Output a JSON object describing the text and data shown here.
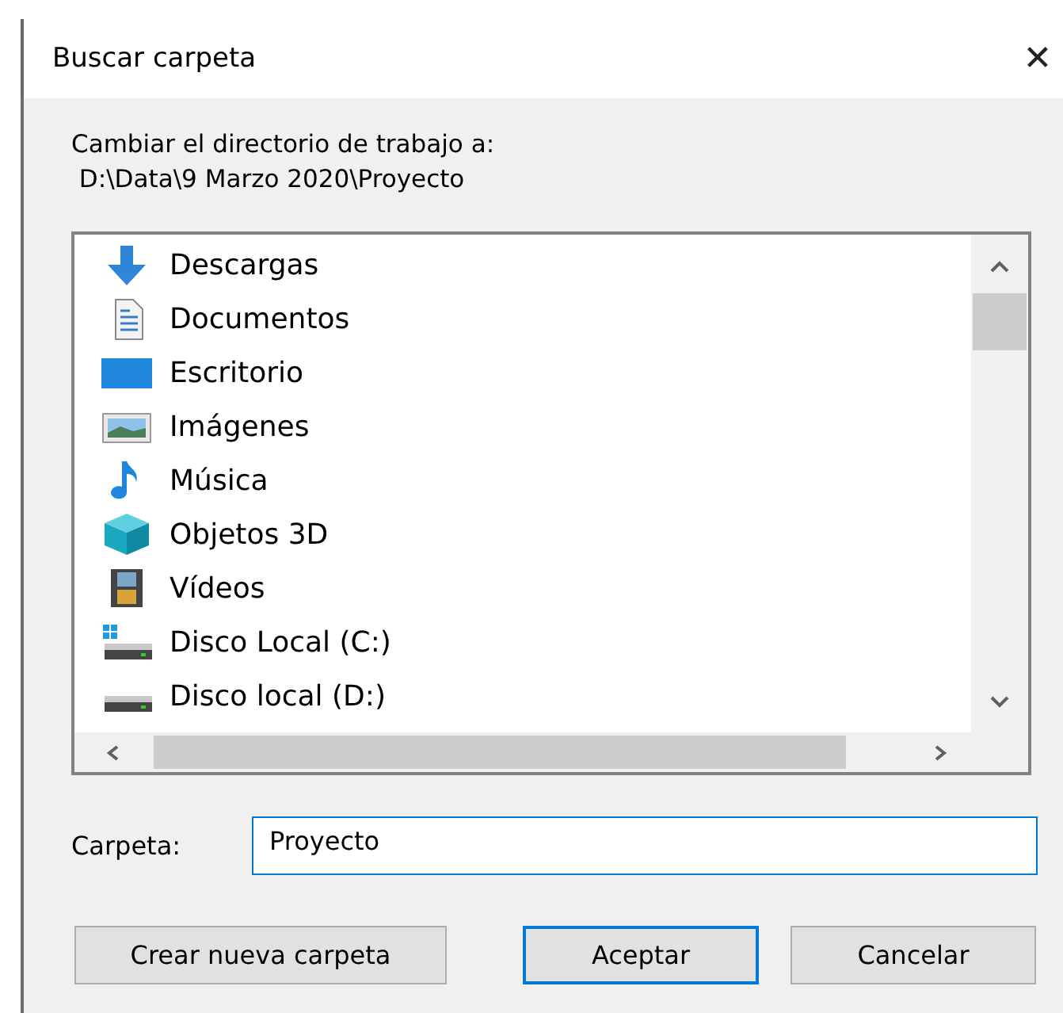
{
  "window": {
    "title": "Buscar carpeta",
    "close": "✕"
  },
  "description": {
    "line_1": "Cambiar el directorio de trabajo a:",
    "line_2": " D:\\Data\\9 Marzo 2020\\Proyecto"
  },
  "tree": {
    "items": [
      {
        "label": "Descargas",
        "kind": "downloads"
      },
      {
        "label": "Documentos",
        "kind": "documents"
      },
      {
        "label": "Escritorio",
        "kind": "desktop"
      },
      {
        "label": "Imágenes",
        "kind": "pictures"
      },
      {
        "label": "Música",
        "kind": "music"
      },
      {
        "label": "Objetos 3D",
        "kind": "objects3d"
      },
      {
        "label": "Vídeos",
        "kind": "videos"
      },
      {
        "label": "Disco Local (C:)",
        "kind": "systemdrive"
      },
      {
        "label": "Disco local (D:)",
        "kind": "drive"
      }
    ]
  },
  "folder_field": {
    "label": "Carpeta:",
    "value": "Proyecto"
  },
  "buttons": [
    {
      "label": "Crear nueva carpeta",
      "default": false
    },
    {
      "label": "Aceptar",
      "default": true
    },
    {
      "label": "Cancelar",
      "default": false
    }
  ]
}
